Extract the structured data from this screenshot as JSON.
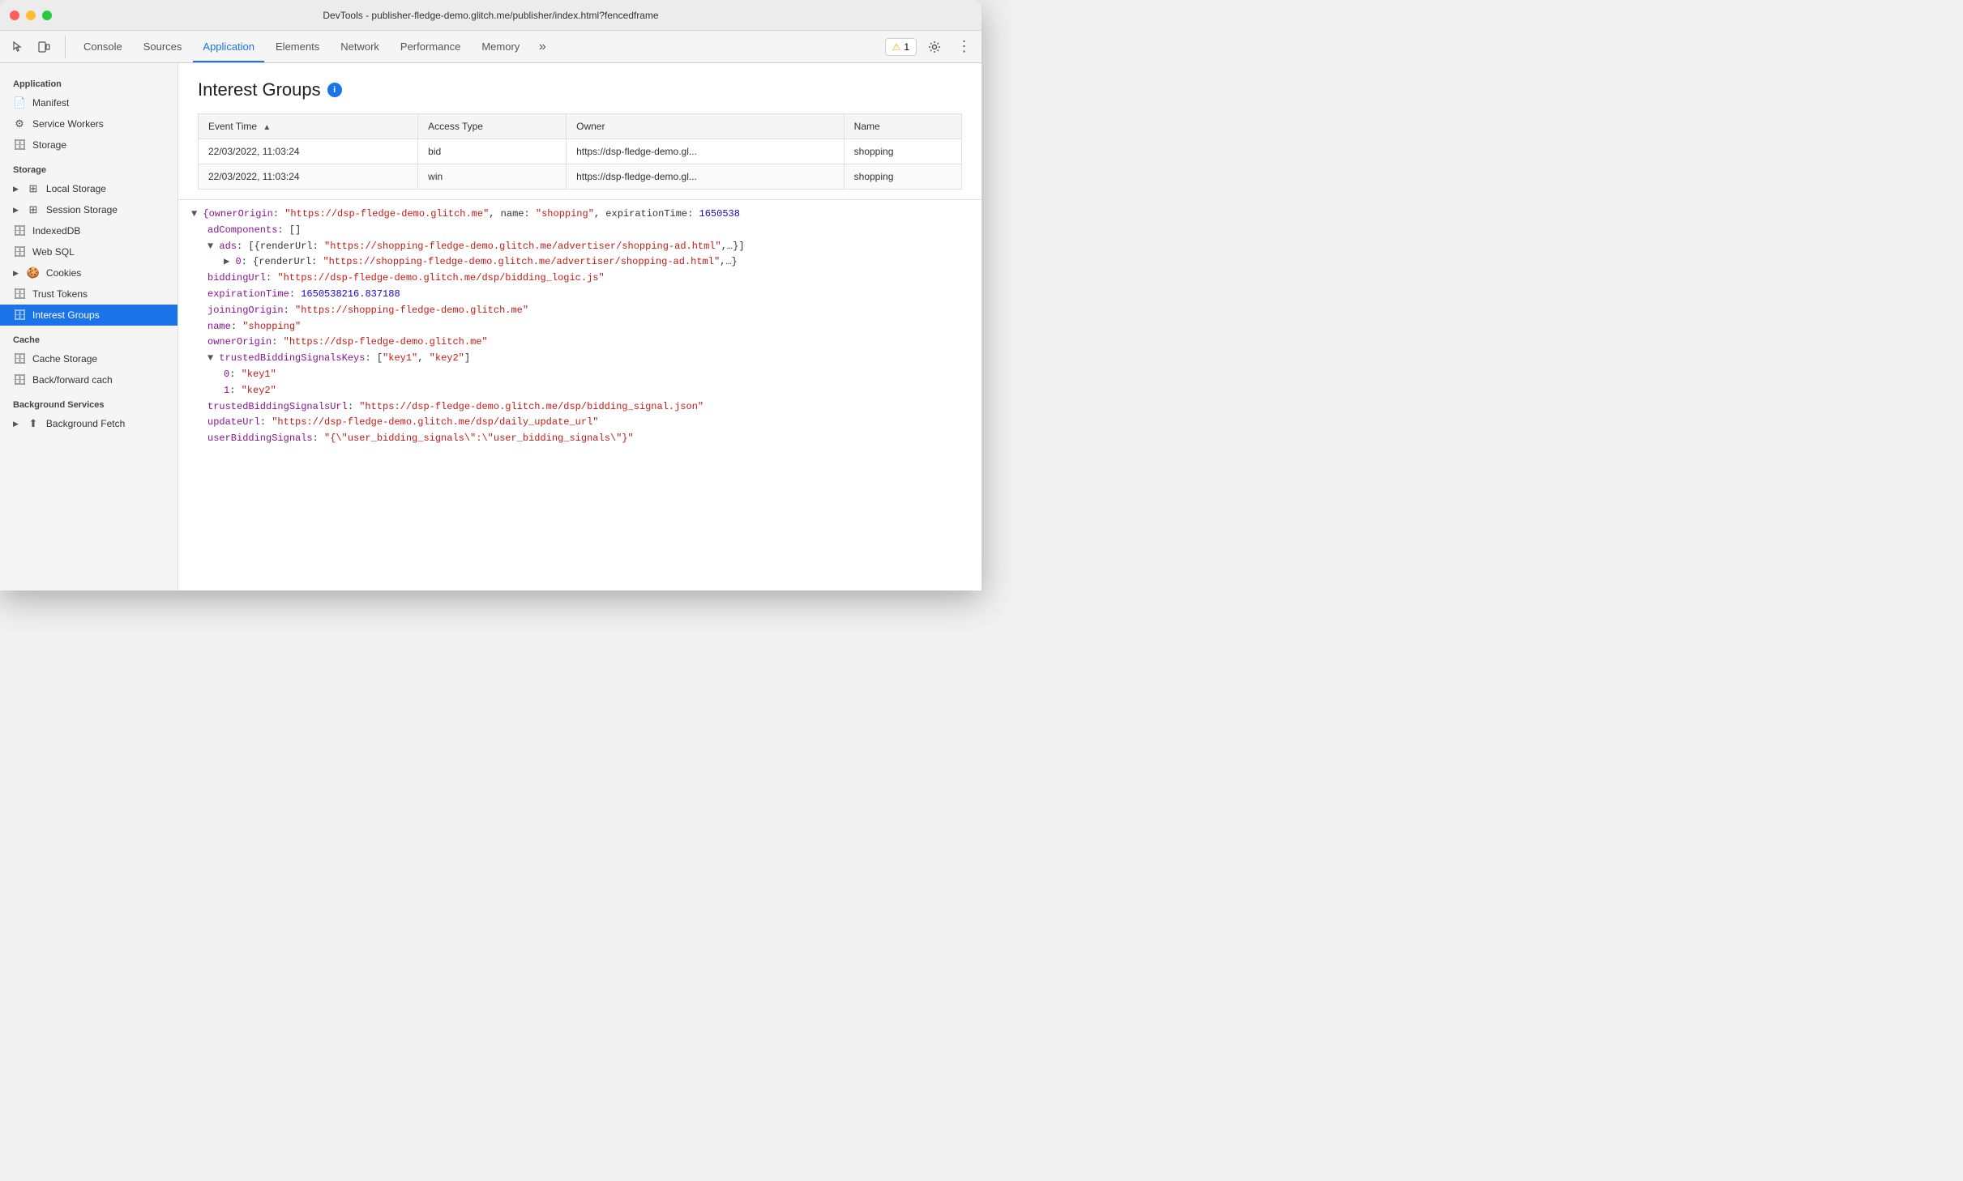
{
  "titleBar": {
    "title": "DevTools - publisher-fledge-demo.glitch.me/publisher/index.html?fencedframe"
  },
  "tabs": [
    {
      "id": "console",
      "label": "Console",
      "active": false
    },
    {
      "id": "sources",
      "label": "Sources",
      "active": false
    },
    {
      "id": "application",
      "label": "Application",
      "active": true
    },
    {
      "id": "elements",
      "label": "Elements",
      "active": false
    },
    {
      "id": "network",
      "label": "Network",
      "active": false
    },
    {
      "id": "performance",
      "label": "Performance",
      "active": false
    },
    {
      "id": "memory",
      "label": "Memory",
      "active": false
    }
  ],
  "warningBadge": {
    "count": "1"
  },
  "sidebar": {
    "sections": [
      {
        "label": "Application",
        "items": [
          {
            "id": "manifest",
            "label": "Manifest",
            "icon": "📄",
            "type": "leaf"
          },
          {
            "id": "service-workers",
            "label": "Service Workers",
            "icon": "⚙️",
            "type": "leaf"
          },
          {
            "id": "storage",
            "label": "Storage",
            "icon": "🗄️",
            "type": "leaf"
          }
        ]
      },
      {
        "label": "Storage",
        "items": [
          {
            "id": "local-storage",
            "label": "Local Storage",
            "icon": "▶ ⊞",
            "type": "expandable"
          },
          {
            "id": "session-storage",
            "label": "Session Storage",
            "icon": "▶ ⊞",
            "type": "expandable"
          },
          {
            "id": "indexeddb",
            "label": "IndexedDB",
            "icon": "🗄️",
            "type": "leaf"
          },
          {
            "id": "web-sql",
            "label": "Web SQL",
            "icon": "🗄️",
            "type": "leaf"
          },
          {
            "id": "cookies",
            "label": "Cookies",
            "icon": "▶ 🍪",
            "type": "expandable"
          },
          {
            "id": "trust-tokens",
            "label": "Trust Tokens",
            "icon": "🗄️",
            "type": "leaf"
          },
          {
            "id": "interest-groups",
            "label": "Interest Groups",
            "icon": "🗄️",
            "type": "leaf",
            "active": true
          }
        ]
      },
      {
        "label": "Cache",
        "items": [
          {
            "id": "cache-storage",
            "label": "Cache Storage",
            "icon": "🗄️",
            "type": "leaf"
          },
          {
            "id": "back-forward-cache",
            "label": "Back/forward cach",
            "icon": "🗄️",
            "type": "leaf"
          }
        ]
      },
      {
        "label": "Background Services",
        "items": [
          {
            "id": "background-fetch",
            "label": "Background Fetch",
            "icon": "▶",
            "type": "expandable"
          }
        ]
      }
    ]
  },
  "interestGroups": {
    "title": "Interest Groups",
    "table": {
      "columns": [
        "Event Time",
        "Access Type",
        "Owner",
        "Name"
      ],
      "rows": [
        {
          "eventTime": "22/03/2022, 11:03:24",
          "accessType": "bid",
          "owner": "https://dsp-fledge-demo.gl...",
          "name": "shopping"
        },
        {
          "eventTime": "22/03/2022, 11:03:24",
          "accessType": "win",
          "owner": "https://dsp-fledge-demo.gl...",
          "name": "shopping"
        }
      ]
    },
    "jsonLines": [
      {
        "indent": 0,
        "content": "{ownerOrigin: \"https://dsp-fledge-demo.glitch.me\", name: \"shopping\", expirationTime: 1650538",
        "type": "collapse"
      },
      {
        "indent": 1,
        "content": "adComponents: []",
        "type": "key-value"
      },
      {
        "indent": 1,
        "content": "ads: [{renderUrl: \"https://shopping-fledge-demo.glitch.me/advertiser/shopping-ad.html\",…}]",
        "type": "expand"
      },
      {
        "indent": 2,
        "content": "▶ 0: {renderUrl: \"https://shopping-fledge-demo.glitch.me/advertiser/shopping-ad.html\",…}",
        "type": "expand-item"
      },
      {
        "indent": 1,
        "content": "biddingUrl: \"https://dsp-fledge-demo.glitch.me/dsp/bidding_logic.js\"",
        "type": "key-string"
      },
      {
        "indent": 1,
        "content": "expirationTime: 1650538216.837188",
        "type": "key-number"
      },
      {
        "indent": 1,
        "content": "joiningOrigin: \"https://shopping-fledge-demo.glitch.me\"",
        "type": "key-string"
      },
      {
        "indent": 1,
        "content": "name: \"shopping\"",
        "type": "key-string"
      },
      {
        "indent": 1,
        "content": "ownerOrigin: \"https://dsp-fledge-demo.glitch.me\"",
        "type": "key-string"
      },
      {
        "indent": 1,
        "content": "trustedBiddingSignalsKeys: [\"key1\", \"key2\"]",
        "type": "expand"
      },
      {
        "indent": 2,
        "content": "0: \"key1\"",
        "type": "key-string"
      },
      {
        "indent": 2,
        "content": "1: \"key2\"",
        "type": "key-string"
      },
      {
        "indent": 1,
        "content": "trustedBiddingSignalsUrl: \"https://dsp-fledge-demo.glitch.me/dsp/bidding_signal.json\"",
        "type": "key-string"
      },
      {
        "indent": 1,
        "content": "updateUrl: \"https://dsp-fledge-demo.glitch.me/dsp/daily_update_url\"",
        "type": "key-string"
      },
      {
        "indent": 1,
        "content": "userBiddingSignals: \"{\\\"user_bidding_signals\\\":\\\"user_bidding_signals\\\"}\"",
        "type": "key-string"
      }
    ]
  }
}
